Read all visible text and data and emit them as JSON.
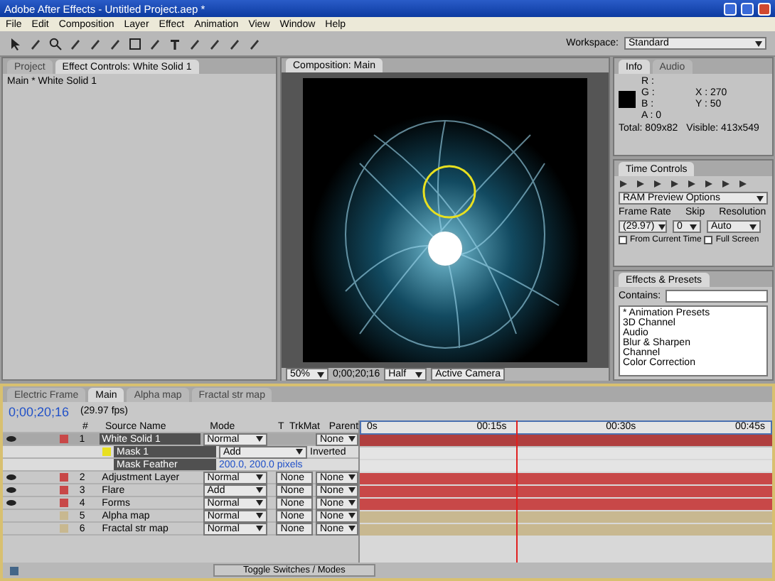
{
  "window": {
    "title": "Adobe After Effects - Untitled Project.aep *"
  },
  "menu": [
    "File",
    "Edit",
    "Composition",
    "Layer",
    "Effect",
    "Animation",
    "View",
    "Window",
    "Help"
  ],
  "workspace": {
    "label": "Workspace:",
    "value": "Standard"
  },
  "left_panel": {
    "tabs": [
      {
        "label": "Project",
        "selected": false
      },
      {
        "label": "Effect Controls: White Solid 1",
        "selected": true
      }
    ],
    "subtitle": "Main * White Solid 1"
  },
  "composition": {
    "tab": "Composition: Main",
    "zoom": "50%",
    "time": "0;00;20;16",
    "resolution": "Half",
    "camera": "Active Camera"
  },
  "info": {
    "tabs": [
      {
        "label": "Info",
        "selected": true
      },
      {
        "label": "Audio",
        "selected": false
      }
    ],
    "left": [
      "R :",
      "G :",
      "B :",
      "A : 0"
    ],
    "right": [
      "X : 270",
      "Y : 50"
    ],
    "total": "Total: 809x82",
    "visible": "Visible: 413x549"
  },
  "time_controls": {
    "title": "Time Controls",
    "preview": "RAM Preview Options",
    "frame_rate_label": "Frame Rate",
    "frame_rate": "(29.97)",
    "skip_label": "Skip",
    "skip": "0",
    "resolution_label": "Resolution",
    "resolution": "Auto",
    "options": [
      {
        "label": "From Current Time",
        "checked": false
      },
      {
        "label": "Full Screen",
        "checked": false
      }
    ]
  },
  "effects": {
    "title": "Effects & Presets",
    "contains_label": "Contains:",
    "items": [
      "* Animation Presets",
      "3D Channel",
      "Audio",
      "Blur & Sharpen",
      "Channel",
      "Color Correction"
    ]
  },
  "timeline": {
    "tabs": [
      {
        "label": "Electric Frame",
        "selected": false
      },
      {
        "label": "Main",
        "selected": true
      },
      {
        "label": "Alpha map",
        "selected": false
      },
      {
        "label": "Fractal str map",
        "selected": false
      }
    ],
    "time": "0;00;20;16",
    "fps": "(29.97 fps)",
    "columns": [
      "#",
      "Source Name",
      "Mode",
      "T",
      "TrkMat",
      "Parent"
    ],
    "ruler": [
      "0s",
      "00:15s",
      "00:30s",
      "00:45s"
    ],
    "playhead": {
      "level": 0.38
    },
    "rows": [
      {
        "kind": "layer",
        "number": "1",
        "name": "White Solid 1",
        "mode": "Normal",
        "trkmat": "",
        "parent": "None",
        "color": "#c84848",
        "visible": true,
        "selected": true
      },
      {
        "kind": "mask",
        "name": "Mask 1",
        "mode": "Add",
        "option": "Inverted",
        "color": "#e8e020"
      },
      {
        "kind": "property",
        "name": "Mask Feather",
        "value": "200.0, 200.0 pixels"
      },
      {
        "kind": "layer",
        "number": "2",
        "name": "Adjustment Layer",
        "mode": "Normal",
        "trkmat": "None",
        "parent": "None",
        "color": "#c84848",
        "visible": true,
        "selected": false
      },
      {
        "kind": "layer",
        "number": "3",
        "name": "Flare",
        "mode": "Add",
        "trkmat": "None",
        "parent": "None",
        "color": "#c84848",
        "visible": true,
        "selected": false
      },
      {
        "kind": "layer",
        "number": "4",
        "name": "Forms",
        "mode": "Normal",
        "trkmat": "None",
        "parent": "None",
        "color": "#c84848",
        "visible": true,
        "selected": false
      },
      {
        "kind": "layer",
        "number": "5",
        "name": "Alpha map",
        "mode": "Normal",
        "trkmat": "None",
        "parent": "None",
        "color": "#c8b890",
        "visible": false,
        "selected": false
      },
      {
        "kind": "layer",
        "number": "6",
        "name": "Fractal str map",
        "mode": "Normal",
        "trkmat": "None",
        "parent": "None",
        "color": "#c8b890",
        "visible": false,
        "selected": false
      }
    ],
    "footer": "Toggle Switches / Modes"
  }
}
